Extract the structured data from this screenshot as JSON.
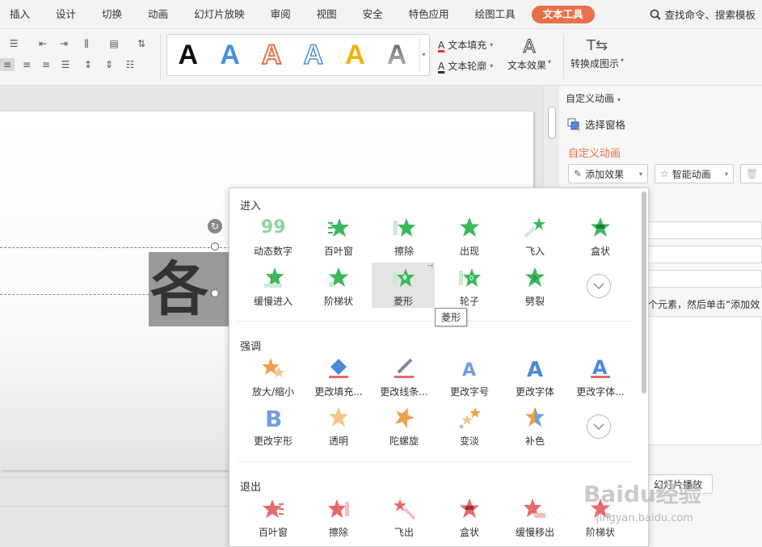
{
  "menubar": {
    "tabs": [
      "插入",
      "设计",
      "切换",
      "动画",
      "幻灯片放映",
      "审阅",
      "视图",
      "安全",
      "特色应用",
      "绘图工具",
      "文本工具"
    ],
    "active": "文本工具",
    "search": "查找命令、搜索模板"
  },
  "ribbon": {
    "text_fill": "文本填充",
    "text_outline": "文本轮廓",
    "text_effect": "文本效果",
    "convert": "转换成图示",
    "wordart_glyph": "A",
    "wordart_colors": [
      "#111111",
      "#4a90d9",
      "#e8704a",
      "#4a90d9",
      "#f2b400",
      "#888888"
    ]
  },
  "slide": {
    "big_text": "各"
  },
  "panel": {
    "title": "自定义动画",
    "select_pane": "选择窗格",
    "section": "自定义动画",
    "add_effect": "添加效果",
    "smart_anim": "智能动画",
    "hint": "个元素，然后单击“添加效",
    "play": "幻灯片播放"
  },
  "popup": {
    "categories": {
      "enter": "进入",
      "emphasis": "强调",
      "exit": "退出"
    },
    "enter": [
      "动态数字",
      "百叶窗",
      "擦除",
      "出现",
      "飞入",
      "盒状",
      "缓慢进入",
      "阶梯状",
      "菱形",
      "轮子",
      "劈裂"
    ],
    "emphasis": [
      "放大/缩小",
      "更改填充...",
      "更改线条...",
      "更改字号",
      "更改字体",
      "更改字体...",
      "更改字形",
      "透明",
      "陀螺旋",
      "变淡",
      "补色"
    ],
    "exit": [
      "百叶窗",
      "擦除",
      "飞出",
      "盒状",
      "缓慢移出",
      "阶梯状"
    ],
    "tooltip": "菱形",
    "icon_glyphs": {
      "dynamic_number": "99",
      "wheel": "0",
      "split": "$",
      "font_b": "B",
      "font_a": "A"
    }
  },
  "watermark": {
    "main": "Baidu经验",
    "sub": "jingyan.baidu.com"
  },
  "colors": {
    "accent": "#e8704a",
    "enter_green": "#3cb95b",
    "emph_orange": "#f0a04b",
    "emph_blue": "#4a8ad9",
    "exit_red": "#e86a6a"
  }
}
